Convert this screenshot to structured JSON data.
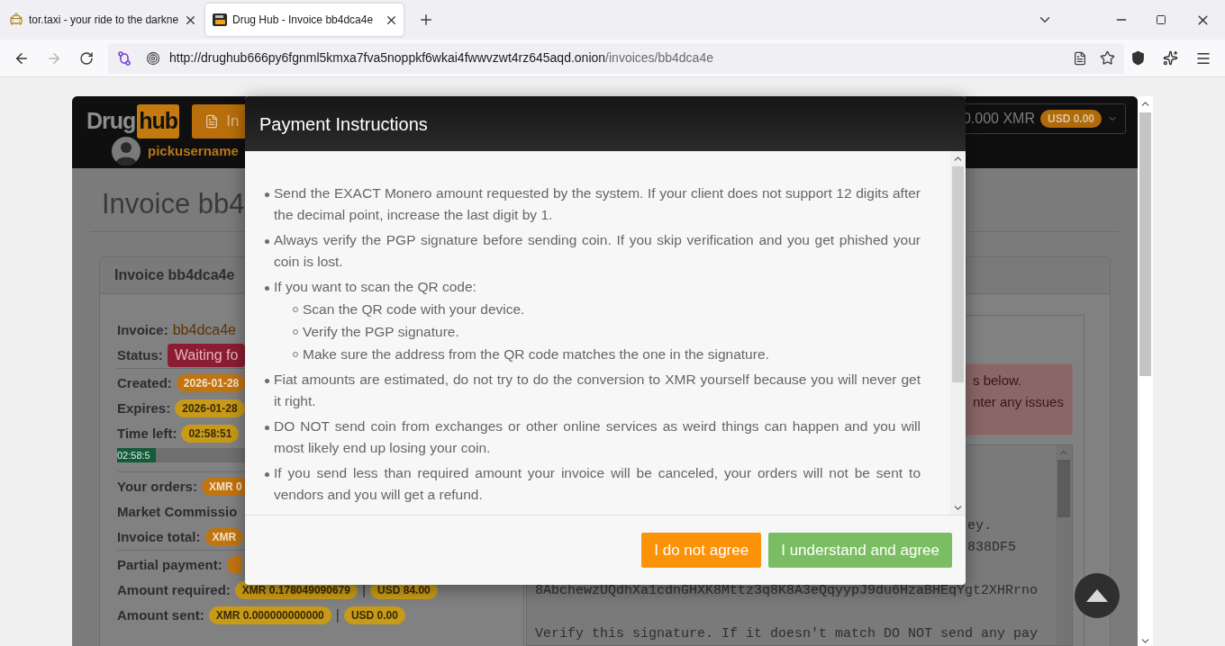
{
  "browser": {
    "tabs": [
      {
        "title": "tor.taxi - your ride to the darkne",
        "selected": false
      },
      {
        "title": "Drug Hub - Invoice bb4dca4e",
        "selected": true
      }
    ],
    "url": {
      "host": "http://drughub666py6fgnml5kmxa7fva5noppkf6wkai4fwwvzwt4rz645aqd.onion",
      "path": "/invoices/bb4dca4e"
    }
  },
  "site_header": {
    "logo_left": "Drug",
    "logo_right": "hub",
    "nav_button": "In",
    "username": "pickusername",
    "balance": "0.000 XMR",
    "balance_usd": "USD 0.00"
  },
  "page": {
    "title": "Invoice bb4",
    "card_title": "Invoice bb4dca4e",
    "groups": [
      [
        {
          "label": "Invoice:",
          "parts": [
            {
              "kind": "link",
              "text": "bb4dca4e"
            }
          ]
        },
        {
          "label": "Status:",
          "parts": [
            {
              "kind": "status",
              "text": "Waiting fo"
            }
          ]
        }
      ],
      [
        {
          "label": "Created:",
          "parts": [
            {
              "kind": "badge",
              "text": "2026-01-28",
              "color": "#c27410"
            }
          ]
        },
        {
          "label": "Expires:",
          "parts": [
            {
              "kind": "badge",
              "text": "2026-01-28",
              "color": "#c79a17"
            }
          ]
        },
        {
          "label": "Time left:",
          "parts": [
            {
              "kind": "badge",
              "text": "02:58:51",
              "color": "#c79a17"
            }
          ]
        },
        {
          "kind": "progress",
          "level": 0.1,
          "text": "02:58:5"
        }
      ],
      [
        {
          "label": "Your orders:",
          "parts": [
            {
              "kind": "badge",
              "text": "XMR 0",
              "color": "#c27410"
            }
          ]
        },
        {
          "label": "Market Commissio"
        },
        {
          "label": "Invoice total:",
          "parts": [
            {
              "kind": "badge",
              "text": "XMR",
              "color": "#c27410"
            }
          ]
        }
      ],
      [
        {
          "label": "Partial payment:",
          "parts": [
            {
              "kind": "badge_edge",
              "color": "#c27410"
            }
          ]
        },
        {
          "label": "Amount required:",
          "parts": [
            {
              "kind": "badge",
              "text": "XMR 0.178049090679",
              "color": "#c79a17"
            },
            {
              "kind": "separator",
              "text": "|"
            },
            {
              "kind": "badge",
              "text": "USD 84.00",
              "color": "#c79a17"
            }
          ]
        },
        {
          "label": "Amount sent:",
          "parts": [
            {
              "kind": "badge",
              "text": "XMR 0.000000000000",
              "color": "#c79a17"
            },
            {
              "kind": "separator",
              "text": "|"
            },
            {
              "kind": "badge",
              "text": "USD 0.00",
              "color": "#c79a17"
            }
          ]
        }
      ]
    ],
    "alert_lines": [
      "s below.",
      "nter any issues"
    ],
    "signature_blocks": [
      [
        {
          "kind": "tail",
          "text": "ey."
        },
        {
          "kind": "tail",
          "text": "838DF5"
        }
      ],
      [
        {
          "kind": "full",
          "text": "8AbchewzUQdhXa1cdnGHXK8Mttz3q8K8A3eQqyypJ9du6HzaBHEqYgt2XHRrno"
        }
      ],
      [
        {
          "kind": "full",
          "text": "Verify this signature. If it doesn't match DO NOT send any pay"
        }
      ]
    ]
  },
  "modal": {
    "title": "Payment Instructions",
    "items": [
      {
        "text": "Send the EXACT Monero amount requested by the system. If your client does not support 12 digits after the decimal point, increase the last digit by 1."
      },
      {
        "text": "Always verify the PGP signature before sending coin. If you skip verification and you get phished your coin is lost."
      },
      {
        "text": "If you want to scan the QR code:",
        "children": [
          {
            "text": "Scan the QR code with your device."
          },
          {
            "text": "Verify the PGP signature."
          },
          {
            "text": "Make sure the address from the QR code matches the one in the signature."
          }
        ]
      },
      {
        "text": "Fiat amounts are estimated, do not try to do the conversion to XMR yourself because you will never get it right."
      },
      {
        "text": "DO NOT send coin from exchanges or other online services as weird things can happen and you will most likely end up losing your coin."
      },
      {
        "text": "If you send less than required amount your invoice will be canceled, your orders will not be sent to vendors and you will get a refund."
      }
    ],
    "buttons": [
      {
        "label": "I do not agree",
        "kind": "warning"
      },
      {
        "label": "I understand and agree",
        "kind": "success"
      }
    ]
  }
}
